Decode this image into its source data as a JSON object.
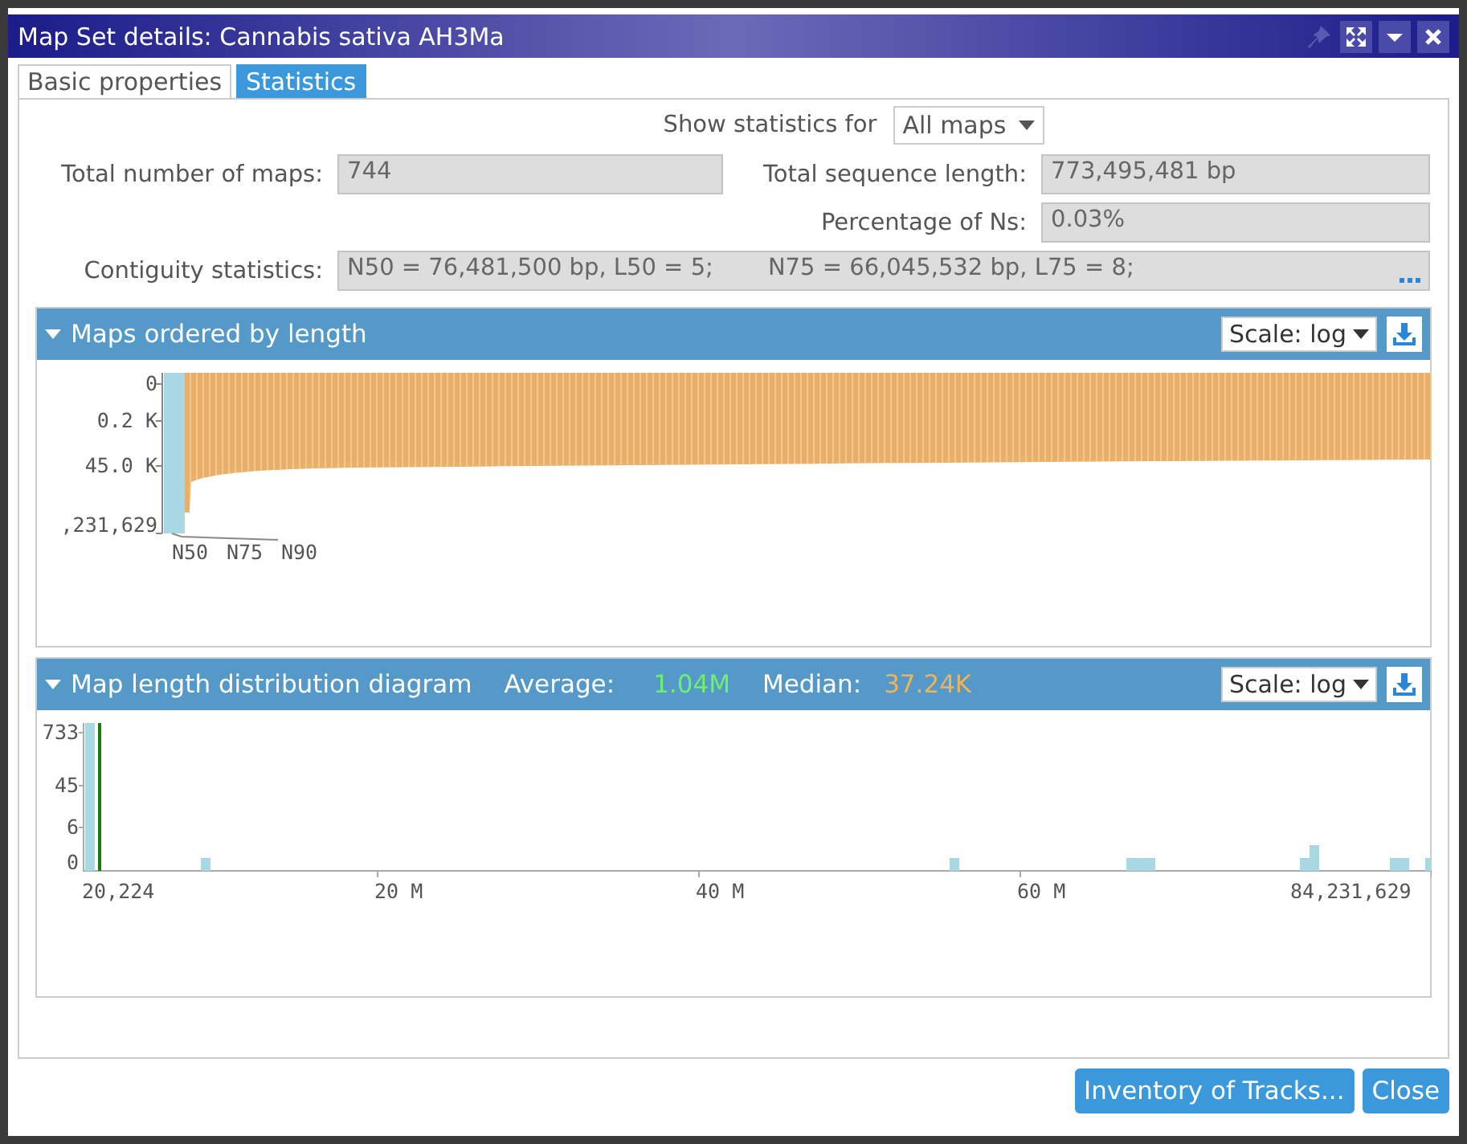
{
  "window": {
    "title": "Map Set details: Cannabis sativa AH3Ma"
  },
  "tabs": [
    {
      "label": "Basic properties",
      "selected": false
    },
    {
      "label": "Statistics",
      "selected": true
    }
  ],
  "filter": {
    "label": "Show statistics for",
    "value": "All maps"
  },
  "fields": [
    {
      "label": "Total number of maps:",
      "value": "744"
    },
    {
      "label": "Total sequence length:",
      "value": "773,495,481 bp"
    },
    {
      "label": "Percentage of Ns:",
      "value": "0.03%"
    }
  ],
  "contiguity": {
    "label": "Contiguity statistics:",
    "parts": [
      "N50 = 76,481,500 bp, L50 = 5;",
      "N75 = 66,045,532 bp, L75 = 8;"
    ]
  },
  "length_panel": {
    "title": "Maps ordered by length",
    "expanded": true,
    "scale": "Scale: log",
    "y_labels": [
      "0",
      "0.2 K",
      "45.0 K",
      ",231,629"
    ],
    "markers": [
      "N50",
      "N75",
      "N90"
    ]
  },
  "distribution_panel": {
    "title": "Map length distribution diagram",
    "expanded": true,
    "average_label": "Average:",
    "average": "1.04M",
    "median_label": "Median:",
    "median": "37.24K",
    "scale": "Scale: log",
    "y_labels": [
      "733",
      "45",
      "6",
      "0"
    ],
    "x_labels": [
      "20,224",
      "20 M",
      "40 M",
      "60 M",
      "84,231,629"
    ]
  },
  "buttons": [
    "Inventory of Tracks...",
    "Close"
  ]
}
